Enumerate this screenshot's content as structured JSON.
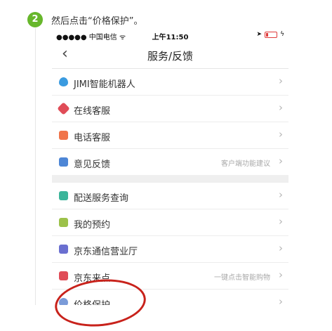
{
  "step": {
    "number": "2",
    "instruction": "然后点击“价格保护”。"
  },
  "status_bar": {
    "carrier": "●●●●● 中国电信 ᯤ",
    "time": "上午11:50"
  },
  "nav": {
    "back": "‹",
    "title": "服务/反馈"
  },
  "groups": [
    {
      "items": [
        {
          "label": "JIMI智能机器人",
          "hint": "",
          "icon": "robot-icon",
          "color": "#3a9be0"
        },
        {
          "label": "在线客服",
          "hint": "",
          "icon": "chat-icon",
          "color": "#e04c57"
        },
        {
          "label": "电话客服",
          "hint": "",
          "icon": "phone-icon",
          "color": "#f0744a"
        },
        {
          "label": "意见反馈",
          "hint": "客户端功能建议",
          "icon": "feedback-icon",
          "color": "#4d86d6"
        }
      ]
    },
    {
      "items": [
        {
          "label": "配送服务查询",
          "hint": "",
          "icon": "delivery-icon",
          "color": "#3bb59a"
        },
        {
          "label": "我的预约",
          "hint": "",
          "icon": "calendar-icon",
          "color": "#9cc14a"
        },
        {
          "label": "京东通信营业厅",
          "hint": "",
          "icon": "telecom-icon",
          "color": "#6a6fd0"
        },
        {
          "label": "京东来点",
          "hint": "一键点击智能购物",
          "icon": "button-icon",
          "color": "#e04c57"
        },
        {
          "label": "价格保护",
          "hint": "",
          "icon": "price-protect-icon",
          "color": "#7a9bd8"
        }
      ]
    }
  ],
  "chevron": "›",
  "annotation_color": "#c8221b"
}
